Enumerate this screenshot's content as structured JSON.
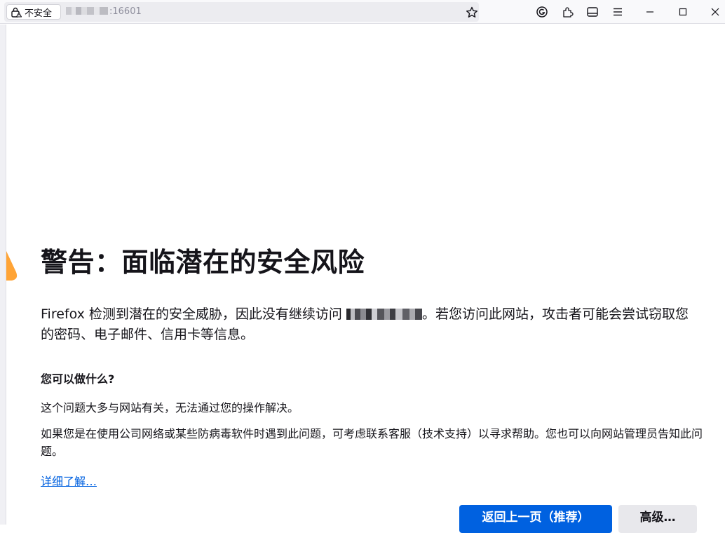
{
  "browser": {
    "security_label": "不安全",
    "url_suffix": ":16601",
    "icons": [
      "lock-warning-icon",
      "star-icon",
      "account-icon",
      "extensions-icon",
      "sidebar-icon",
      "menu-icon",
      "minimize-icon",
      "maximize-icon",
      "close-icon"
    ]
  },
  "page": {
    "title": "警告：面临潜在的安全风险",
    "intro_before": "Firefox 检测到潜在的安全威胁，因此没有继续访问 ",
    "intro_after": "。若您访问此网站，攻击者可能会尝试窃取您的密码、电子邮件、信用卡等信息。",
    "what_heading": "您可以做什么?",
    "para1": "这个问题大多与网站有关，无法通过您的操作解决。",
    "para2": "如果您是在使用公司网络或某些防病毒软件时遇到此问题，可考虑联系客服（技术支持）以寻求帮助。您也可以向网站管理员告知此问题。",
    "learn_more": "详细了解…",
    "btn_back": "返回上一页（推荐）",
    "btn_advanced": "高级…"
  },
  "colors": {
    "accent": "#0061e0",
    "warning": "#ffa436"
  }
}
